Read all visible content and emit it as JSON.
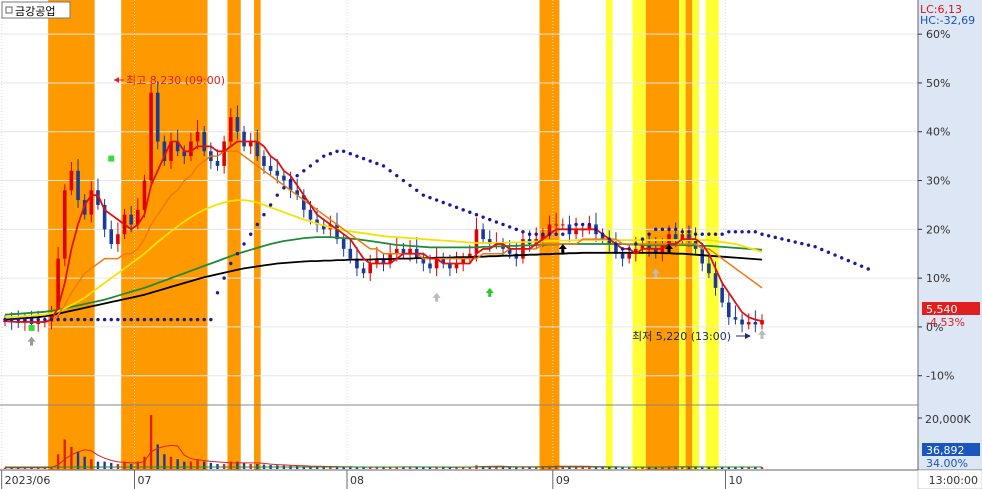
{
  "title": "금강공업",
  "indicators": {
    "lc": "LC:6,13",
    "hc": "HC:-32,69"
  },
  "price_tag": {
    "value": "5,540",
    "change": "-4.53%"
  },
  "annotations": {
    "high": "최고 8,230 (09:00)",
    "low": "최저 5,220 (13:00)"
  },
  "colors": {
    "orange_band": "#ff9900",
    "yellow_band": "#ffff33",
    "candle_up": "#e00000",
    "candle_down": "#1a3a9a",
    "dot_line": "#1a1a9a"
  },
  "volume_panel": {
    "label_top": "20,000K",
    "value_tag": "36,892",
    "pct_tag": "34.00%"
  },
  "time_readout": "13:00:00",
  "chart_data": {
    "type": "line",
    "title": "",
    "x_ticks": [
      "2023/06",
      "07",
      "08",
      "09",
      "10"
    ],
    "y_ticks": [
      "60%",
      "50%",
      "40%",
      "30%",
      "20%",
      "10%",
      "0%",
      "-10%"
    ],
    "y_tick_values": [
      60,
      50,
      40,
      30,
      20,
      10,
      0,
      -10
    ],
    "ylim": [
      -16,
      67
    ],
    "n_bars": 115,
    "month_start_index": [
      0,
      20,
      52,
      83,
      109
    ],
    "series": [
      {
        "name": "price",
        "values": [
          1.2,
          1.0,
          0.8,
          1.5,
          0.6,
          0.9,
          1.1,
          2.5,
          14,
          28,
          32,
          26,
          23,
          28,
          25,
          20,
          17,
          19,
          23,
          21,
          24,
          30,
          48,
          38,
          34,
          38,
          36,
          35,
          38,
          40,
          36,
          34,
          33,
          38,
          43,
          40,
          37,
          38,
          35,
          33,
          32,
          31,
          30,
          28,
          27,
          24,
          22,
          21,
          20,
          21,
          18,
          16,
          14,
          12,
          11,
          13,
          14,
          13,
          15,
          16,
          15,
          16,
          14,
          13,
          12,
          14,
          13,
          12,
          13,
          14,
          15,
          20,
          18,
          17,
          17,
          16,
          15,
          14,
          18,
          17,
          18,
          19,
          21,
          21,
          21,
          19,
          20,
          20,
          21,
          19,
          18,
          17,
          15,
          14,
          15,
          16,
          17,
          16,
          15,
          17,
          19,
          18,
          19,
          18,
          16,
          13,
          11,
          8,
          5,
          2,
          1.5,
          0.5,
          1.0,
          0.5,
          1.4
        ]
      },
      {
        "name": "ma5",
        "values": [
          1.2,
          1.1,
          1.0,
          1.1,
          1.0,
          1.0,
          1.0,
          1.5,
          4,
          9,
          16,
          21,
          25,
          27,
          27,
          24,
          23,
          22,
          21,
          20,
          21,
          23,
          29,
          32,
          35,
          38,
          38,
          36,
          36,
          37,
          37,
          37,
          36,
          36,
          37,
          38,
          38,
          38,
          38,
          37,
          35,
          34,
          32,
          31,
          29,
          27,
          25,
          23,
          22,
          21,
          20,
          19,
          18,
          16,
          14,
          13,
          13,
          13,
          13,
          14,
          15,
          15,
          15,
          15,
          14,
          14,
          13,
          13,
          13,
          13,
          13,
          15,
          16,
          16,
          17,
          17,
          16,
          16,
          16,
          16,
          17,
          18,
          19,
          20,
          20,
          20,
          20,
          20,
          20,
          20,
          19,
          18,
          17,
          16,
          16,
          15,
          16,
          16,
          16,
          16,
          17,
          17,
          18,
          18,
          18,
          17,
          15,
          12,
          9,
          7,
          5,
          3,
          2,
          1.5,
          1.2
        ]
      },
      {
        "name": "ma20",
        "values": [
          1.2,
          1.1,
          1.0,
          1.0,
          1.0,
          1.0,
          1.0,
          1.2,
          2.5,
          4.5,
          7,
          9,
          11,
          12,
          13,
          14,
          14,
          14,
          15,
          15,
          16,
          18,
          21,
          23,
          25,
          27,
          28,
          30,
          31,
          33,
          34,
          35,
          35,
          36,
          36,
          36,
          35,
          34,
          33,
          32,
          31,
          30,
          29,
          28,
          27,
          26,
          25,
          24,
          23,
          22,
          21,
          20,
          19,
          18,
          17,
          16,
          16,
          15,
          15,
          15,
          15,
          15,
          15,
          14,
          14,
          14,
          14,
          14,
          14,
          14,
          14,
          14,
          15,
          15,
          15,
          15,
          16,
          16,
          16,
          16,
          16,
          17,
          17,
          17,
          17,
          17,
          17,
          18,
          18,
          18,
          18,
          18,
          18,
          17,
          17,
          17,
          17,
          17,
          17,
          17,
          17,
          17,
          17,
          17,
          17,
          16,
          16,
          15,
          14,
          13,
          12,
          11,
          10,
          9,
          8
        ]
      },
      {
        "name": "ma60",
        "values": [
          2.0,
          2.0,
          2.1,
          2.2,
          2.3,
          2.4,
          2.5,
          2.8,
          3.2,
          3.8,
          4.5,
          5.2,
          6.0,
          7.0,
          8.0,
          9.0,
          10.0,
          11.0,
          12.0,
          13.0,
          14.0,
          15.0,
          16.2,
          17.4,
          18.5,
          19.6,
          20.6,
          21.6,
          22.5,
          23.3,
          24.0,
          24.6,
          25.1,
          25.5,
          25.8,
          26.0,
          26.0,
          25.8,
          25.5,
          25.0,
          24.5,
          24.0,
          23.5,
          23.0,
          22.5,
          22.0,
          21.6,
          21.2,
          20.8,
          20.4,
          20.1,
          19.8,
          19.6,
          19.4,
          19.2,
          19.0,
          18.8,
          18.6,
          18.5,
          18.4,
          18.3,
          18.2,
          18.1,
          18.0,
          17.9,
          17.8,
          17.7,
          17.6,
          17.5,
          17.4,
          17.3,
          17.2,
          17.2,
          17.2,
          17.2,
          17.2,
          17.3,
          17.3,
          17.4,
          17.4,
          17.5,
          17.5,
          17.6,
          17.6,
          17.7,
          17.7,
          17.8,
          17.8,
          17.8,
          17.8,
          17.8,
          17.8,
          17.8,
          17.8,
          17.8,
          17.8,
          17.8,
          17.8,
          17.8,
          17.8,
          17.8,
          17.8,
          17.8,
          17.8,
          17.8,
          17.8,
          17.8,
          17.6,
          17.4,
          17.2,
          17.0,
          16.6,
          16.2,
          15.8,
          15.4
        ]
      },
      {
        "name": "ma120",
        "values": [
          2.5,
          2.6,
          2.7,
          2.8,
          2.9,
          3.0,
          3.1,
          3.3,
          3.5,
          3.8,
          4.1,
          4.4,
          4.7,
          5.0,
          5.3,
          5.6,
          6.0,
          6.4,
          6.8,
          7.2,
          7.6,
          8.0,
          8.5,
          9.0,
          9.5,
          10.0,
          10.5,
          11.0,
          11.5,
          12.0,
          12.5,
          13.0,
          13.5,
          14.0,
          14.5,
          15.0,
          15.4,
          15.8,
          16.2,
          16.6,
          17.0,
          17.3,
          17.6,
          17.8,
          18.0,
          18.2,
          18.3,
          18.4,
          18.4,
          18.4,
          18.3,
          18.2,
          18.1,
          18.0,
          17.8,
          17.6,
          17.4,
          17.2,
          17.0,
          16.8,
          16.7,
          16.6,
          16.5,
          16.4,
          16.3,
          16.3,
          16.3,
          16.3,
          16.3,
          16.3,
          16.3,
          16.3,
          16.4,
          16.4,
          16.5,
          16.5,
          16.6,
          16.6,
          16.7,
          16.7,
          16.8,
          16.8,
          16.9,
          16.9,
          17.0,
          17.0,
          17.0,
          17.0,
          17.0,
          17.0,
          17.0,
          17.0,
          17.0,
          17.0,
          16.9,
          16.9,
          16.8,
          16.8,
          16.8,
          16.8,
          16.8,
          16.8,
          16.8,
          16.7,
          16.7,
          16.6,
          16.6,
          16.5,
          16.4,
          16.3,
          16.2,
          16.1,
          16.0,
          15.9,
          15.8
        ]
      },
      {
        "name": "long_ma",
        "values": [
          1.5,
          1.6,
          1.7,
          1.8,
          1.9,
          2.0,
          2.2,
          2.4,
          2.7,
          3.0,
          3.3,
          3.6,
          3.9,
          4.2,
          4.5,
          4.8,
          5.1,
          5.4,
          5.7,
          6.0,
          6.3,
          6.6,
          7.0,
          7.4,
          7.8,
          8.2,
          8.6,
          9.0,
          9.4,
          9.8,
          10.2,
          10.5,
          10.8,
          11.1,
          11.4,
          11.7,
          12.0,
          12.2,
          12.4,
          12.6,
          12.8,
          13.0,
          13.1,
          13.2,
          13.3,
          13.4,
          13.5,
          13.5,
          13.6,
          13.6,
          13.7,
          13.7,
          13.8,
          13.8,
          13.8,
          13.8,
          13.9,
          13.9,
          13.9,
          14.0,
          14.0,
          14.0,
          14.1,
          14.1,
          14.1,
          14.2,
          14.2,
          14.2,
          14.3,
          14.3,
          14.3,
          14.4,
          14.4,
          14.5,
          14.5,
          14.6,
          14.6,
          14.7,
          14.7,
          14.8,
          14.8,
          14.9,
          14.9,
          15.0,
          15.0,
          15.1,
          15.1,
          15.2,
          15.2,
          15.2,
          15.2,
          15.2,
          15.2,
          15.2,
          15.2,
          15.2,
          15.2,
          15.2,
          15.2,
          15.1,
          15.1,
          15.0,
          15.0,
          14.9,
          14.8,
          14.7,
          14.6,
          14.5,
          14.4,
          14.3,
          14.2,
          14.1,
          14.0,
          13.9,
          13.8
        ]
      },
      {
        "name": "dotted",
        "values": [
          1.5,
          1.5,
          1.5,
          1.5,
          1.5,
          1.5,
          1.5,
          1.5,
          1.5,
          1.5,
          1.5,
          1.5,
          1.5,
          1.5,
          1.5,
          1.5,
          1.5,
          1.5,
          1.5,
          1.5,
          1.5,
          1.5,
          1.5,
          1.5,
          1.5,
          1.5,
          1.5,
          1.5,
          1.5,
          1.5,
          1.5,
          1.5,
          7,
          10,
          13,
          15,
          17,
          19,
          21,
          23,
          25,
          27,
          28.5,
          30,
          31,
          32,
          33,
          34,
          35,
          35.5,
          36,
          36,
          35.5,
          35,
          34.5,
          34,
          33.5,
          33,
          32,
          31,
          30,
          29,
          28,
          27,
          26.5,
          26,
          25.5,
          25,
          24.5,
          24,
          23.5,
          23,
          22.5,
          22,
          21.5,
          21,
          20.5,
          20,
          19.5,
          19,
          19,
          19,
          19,
          19,
          19,
          20,
          21,
          21,
          21,
          20,
          19,
          18,
          17,
          16,
          16,
          17,
          18,
          19,
          20,
          20,
          20,
          20,
          19.5,
          19.5,
          19,
          19,
          19,
          19,
          19,
          19.5,
          19.5,
          19.5,
          19.5,
          19.5,
          19
        ]
      },
      {
        "name": "volume",
        "values": [
          0.5,
          0.5,
          0.4,
          0.6,
          0.5,
          0.6,
          0.5,
          1.0,
          6,
          12,
          9,
          7,
          5,
          4,
          3,
          3,
          2.5,
          2,
          3,
          2,
          3,
          5,
          22,
          10,
          6,
          5,
          4,
          3,
          3,
          4,
          3,
          2.5,
          2,
          2,
          3,
          3,
          2.5,
          2,
          2,
          1.8,
          1.6,
          1.5,
          1.4,
          1.3,
          1.2,
          1.1,
          1.0,
          1.0,
          1.0,
          0.9,
          0.9,
          0.8,
          0.8,
          0.7,
          0.7,
          0.8,
          0.8,
          0.8,
          0.8,
          0.9,
          0.9,
          0.8,
          0.8,
          0.7,
          0.7,
          0.8,
          0.8,
          0.7,
          0.7,
          0.8,
          0.8,
          1.5,
          1.2,
          1.0,
          0.9,
          0.9,
          0.8,
          0.8,
          1.0,
          0.9,
          1.0,
          1.1,
          1.2,
          1.2,
          1.2,
          1.0,
          1.0,
          1.0,
          1.0,
          0.9,
          0.9,
          0.8,
          0.8,
          0.7,
          0.8,
          0.8,
          0.8,
          0.8,
          0.8,
          0.9,
          1.0,
          0.9,
          0.9,
          0.8,
          0.8,
          0.8,
          0.8,
          0.8,
          0.8,
          0.8,
          0.8,
          0.8,
          0.8,
          0.8,
          0.8
        ]
      }
    ],
    "shaded_ranges": [
      {
        "start": 7,
        "end": 13,
        "color": "orange"
      },
      {
        "start": 18,
        "end": 30,
        "color": "orange"
      },
      {
        "start": 34,
        "end": 35,
        "color": "orange"
      },
      {
        "start": 38,
        "end": 38,
        "color": "orange"
      },
      {
        "start": 81,
        "end": 83,
        "color": "orange"
      },
      {
        "start": 91,
        "end": 91,
        "color": "yellow"
      },
      {
        "start": 95,
        "end": 96,
        "color": "yellow"
      },
      {
        "start": 97,
        "end": 101,
        "color": "orange"
      },
      {
        "start": 102,
        "end": 102,
        "color": "yellow"
      },
      {
        "start": 103,
        "end": 103,
        "color": "orange"
      },
      {
        "start": 104,
        "end": 104,
        "color": "yellow"
      },
      {
        "start": 106,
        "end": 107,
        "color": "yellow"
      }
    ]
  }
}
